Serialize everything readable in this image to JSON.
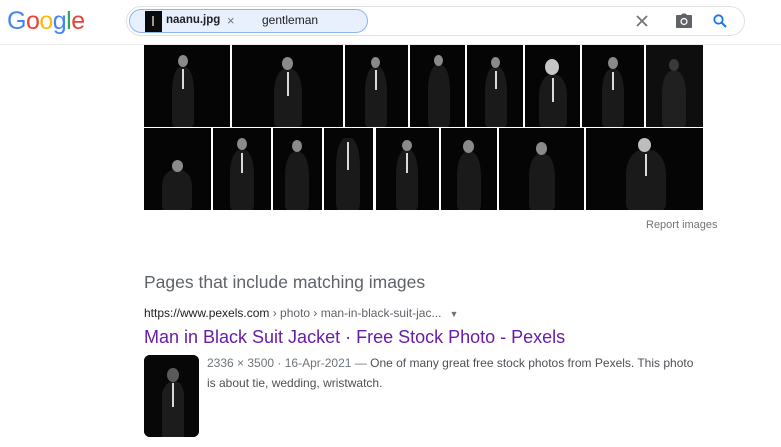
{
  "logo": {
    "text": "Google",
    "colors": [
      "#4285F4",
      "#EA4335",
      "#FBBC05",
      "#4285F4",
      "#34A853",
      "#EA4335"
    ]
  },
  "search": {
    "image_chip_label": "naanu.jpg",
    "image_chip_close": "×",
    "query": "gentleman"
  },
  "results": {
    "report_images": "Report images",
    "matching_heading": "Pages that include matching images",
    "items": [
      {
        "url_host": "https://www.pexels.com",
        "url_path": " › photo › man-in-black-suit-jac...",
        "title": "Man in Black Suit Jacket · Free Stock Photo - Pexels",
        "meta": "2336 × 3500 · 16-Apr-2021 —",
        "snippet": " One of many great free stock photos from Pexels. This photo is about tie, wedding, wristwatch."
      }
    ]
  },
  "colors": {
    "link_visited": "#681da8",
    "accent_blue": "#1a73e8",
    "chip_bg": "#e8f0fe"
  }
}
